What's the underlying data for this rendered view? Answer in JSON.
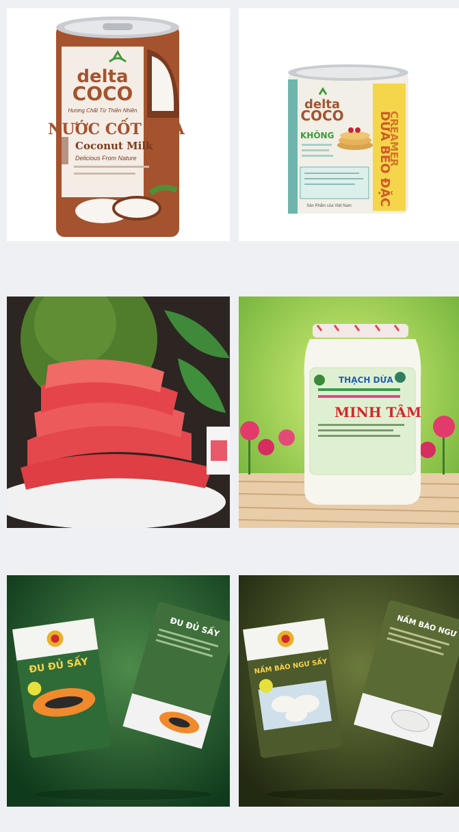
{
  "products": [
    {
      "brand_top": "delta",
      "brand_bottom": "COCO",
      "tagline": "Hương Chất Từ Thiên Nhiên",
      "title": "NƯỚC CỐT DỪA",
      "subtitle": "Coconut Milk",
      "subtitle2": "Delicious From Nature"
    },
    {
      "brand_top": "delta",
      "brand_bottom": "COCO",
      "side_line1": "CREAMER",
      "side_line2": "DỪA BÉO ĐẶC",
      "khong": "KHÔNG",
      "footer": "Sản Phẩm của Việt Nam"
    },
    {},
    {
      "label_top": "THẠCH DỪA",
      "label_main": "MINH TÂM"
    },
    {
      "title": "ĐU ĐỦ SẤY",
      "back_title": "ĐU ĐỦ SẤY"
    },
    {
      "title": "NẤM BÀO NGƯ SẤY",
      "back_title": "NẤM BÀO NGƯ SẤY"
    }
  ],
  "colors": {
    "page_bg": "#eef0f3",
    "coconut_brown": "#a4532e",
    "delta_green": "#3d9a3a",
    "pomelo_red": "#e4474c",
    "papaya_green": "#2f6b36",
    "mushroom_olive": "#4d5a2c"
  }
}
